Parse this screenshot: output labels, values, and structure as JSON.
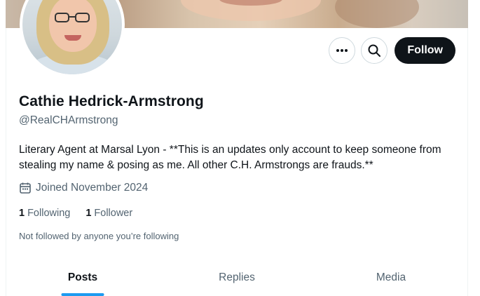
{
  "profile": {
    "display_name": "Cathie Hedrick-Armstrong",
    "handle": "@RealCHArmstrong",
    "bio": "Literary Agent at Marsal Lyon - **This is an updates only account to keep someone from stealing my name & posing as me. All other C.H. Armstrongs are frauds.**",
    "joined": "Joined November 2024",
    "following_count": "1",
    "following_label": "Following",
    "followers_count": "1",
    "followers_label": "Follower",
    "not_followed": "Not followed by anyone you’re following"
  },
  "actions": {
    "more_icon": "more-dots-icon",
    "search_icon": "search-icon",
    "follow_label": "Follow"
  },
  "tabs": [
    {
      "label": "Posts",
      "active": true
    },
    {
      "label": "Replies",
      "active": false
    },
    {
      "label": "Media",
      "active": false
    }
  ],
  "colors": {
    "accent": "#1d9bf0",
    "text_primary": "#0f1419",
    "text_secondary": "#536471",
    "follow_button_bg": "#0f1419"
  }
}
